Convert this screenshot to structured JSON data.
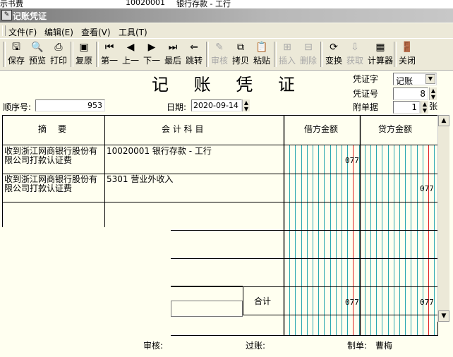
{
  "background_row": {
    "c1": "示书费",
    "c2": "10020001",
    "c3": "银行存款 - 工行"
  },
  "window": {
    "title": "记账凭证"
  },
  "menu": [
    {
      "label": "文件(F)"
    },
    {
      "label": "编辑(E)"
    },
    {
      "label": "查看(V)"
    },
    {
      "label": "工具(T)"
    }
  ],
  "toolbar": [
    {
      "label": "保存",
      "icon": "save-icon",
      "enabled": true
    },
    {
      "label": "预览",
      "icon": "preview-icon",
      "enabled": true
    },
    {
      "label": "打印",
      "icon": "print-icon",
      "enabled": true
    },
    {
      "label": "复原",
      "icon": "restore-icon",
      "enabled": true
    },
    {
      "label": "第一",
      "icon": "first-icon",
      "enabled": true
    },
    {
      "label": "上一",
      "icon": "prev-icon",
      "enabled": true
    },
    {
      "label": "下一",
      "icon": "next-icon",
      "enabled": true
    },
    {
      "label": "最后",
      "icon": "last-icon",
      "enabled": true
    },
    {
      "label": "跳转",
      "icon": "goto-icon",
      "enabled": true
    },
    {
      "label": "审核",
      "icon": "audit-icon",
      "enabled": false
    },
    {
      "label": "拷贝",
      "icon": "copy-icon",
      "enabled": true
    },
    {
      "label": "粘贴",
      "icon": "paste-icon",
      "enabled": true
    },
    {
      "label": "插入",
      "icon": "insert-icon",
      "enabled": false
    },
    {
      "label": "删除",
      "icon": "delete-icon",
      "enabled": false
    },
    {
      "label": "变换",
      "icon": "transform-icon",
      "enabled": true
    },
    {
      "label": "获取",
      "icon": "fetch-icon",
      "enabled": false
    },
    {
      "label": "计算器",
      "icon": "calculator-icon",
      "enabled": true
    },
    {
      "label": "关闭",
      "icon": "close-door-icon",
      "enabled": true
    }
  ],
  "voucher": {
    "title": "记 账 凭 证",
    "seq_label": "顺序号:",
    "seq_value": "953",
    "date_label": "日期:",
    "date_value": "2020-09-14",
    "word_label": "凭证字",
    "word_value": "记账",
    "number_label": "凭证号",
    "number_value": "8",
    "attach_label": "附单据",
    "attach_value": "1",
    "attach_unit": "张"
  },
  "table": {
    "headers": {
      "summary": "摘　要",
      "account": "会 计 科 目",
      "debit": "借方金额",
      "credit": "贷方金额"
    },
    "rows": [
      {
        "summary": "收到浙江网商银行股份有限公司打款认证费",
        "account": "10020001 银行存款 - 工行",
        "debit": "077",
        "credit": ""
      },
      {
        "summary": "收到浙江网商银行股份有限公司打款认证费",
        "account": "5301 营业外收入",
        "debit": "",
        "credit": "077"
      }
    ],
    "total_label": "合计",
    "total_debit": "077",
    "total_credit": "077"
  },
  "footer": {
    "audit_label": "审核:",
    "post_label": "过账:",
    "maker_label": "制单:",
    "maker_value": "曹梅"
  },
  "colors": {
    "grid_cyan": "#2aa8b0",
    "grid_red": "#e02020",
    "background": "#fffff0",
    "toolbar": "#ece9d8"
  }
}
